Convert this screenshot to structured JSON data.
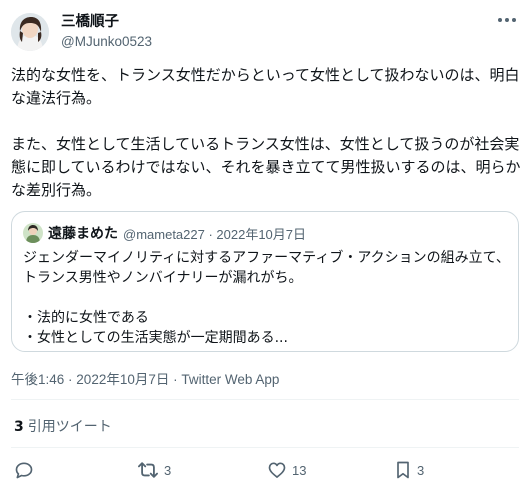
{
  "author": {
    "display_name": "三橋順子",
    "handle": "@MJunko0523"
  },
  "tweet": {
    "paragraphs": [
      "法的な女性を、トランス女性だからといって女性として扱わないのは、明白な違法行為。",
      "また、女性として生活しているトランス女性は、女性として扱うのが社会実態に即しているわけではない、それを暴き立てて男性扱いするのは、明らかな差別行為。"
    ]
  },
  "quoted_tweet": {
    "display_name": "遠藤まめた",
    "meta": "@mameta227 · 2022年10月7日",
    "lines": [
      "ジェンダーマイノリティに対するアファーマティブ・アクションの組み立て、トランス男性やノンバイナリーが漏れがち。",
      "",
      "・法的に女性である",
      "・女性としての生活実態が一定期間ある..."
    ]
  },
  "timestamp": {
    "time": "午後1:46",
    "date": "2022年10月7日",
    "source": "Twitter Web App"
  },
  "quote_tweets": {
    "count": "3",
    "label": "引用ツイート"
  },
  "actions": {
    "reply_count": "",
    "retweet_count": "3",
    "like_count": "13",
    "bookmark_count": "3"
  },
  "icons": [
    "more-icon",
    "reply-icon",
    "retweet-icon",
    "like-icon",
    "bookmark-icon"
  ],
  "colors": {
    "text": "#0f1419",
    "secondary": "#536471",
    "border": "#cfd9de"
  }
}
